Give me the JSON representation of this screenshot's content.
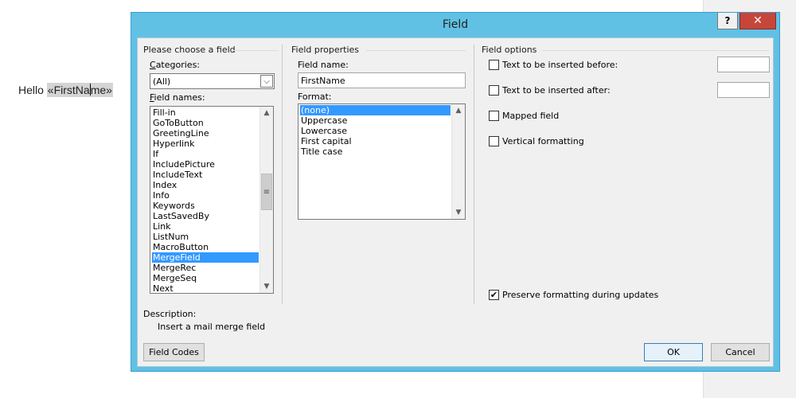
{
  "document": {
    "text_before": "Hello ",
    "field_part1": "«FirstNa",
    "field_part2": "me»"
  },
  "dialog": {
    "title": "Field",
    "help_label": "?",
    "close_label": "✕",
    "choose_group": {
      "title": "Please choose a field",
      "categories_label": "Categories:",
      "categories_value": "(All)",
      "field_names_label": "Field names:",
      "field_names": [
        "Fill-in",
        "GoToButton",
        "GreetingLine",
        "Hyperlink",
        "If",
        "IncludePicture",
        "IncludeText",
        "Index",
        "Info",
        "Keywords",
        "LastSavedBy",
        "Link",
        "ListNum",
        "MacroButton",
        "MergeField",
        "MergeRec",
        "MergeSeq",
        "Next"
      ],
      "selected_field": "MergeField"
    },
    "properties_group": {
      "title": "Field properties",
      "field_name_label": "Field name:",
      "field_name_value": "FirstName",
      "format_label": "Format:",
      "formats": [
        "(none)",
        "Uppercase",
        "Lowercase",
        "First capital",
        "Title case"
      ],
      "selected_format": "(none)"
    },
    "options_group": {
      "title": "Field options",
      "options": [
        {
          "label": "Text to be inserted before:",
          "checked": false,
          "has_input": true,
          "value": ""
        },
        {
          "label": "Text to be inserted after:",
          "checked": false,
          "has_input": true,
          "value": ""
        },
        {
          "label": "Mapped field",
          "checked": false,
          "has_input": false
        },
        {
          "label": "Vertical formatting",
          "checked": false,
          "has_input": false
        }
      ],
      "preserve_label": "Preserve formatting during updates",
      "preserve_checked": true
    },
    "description_label": "Description:",
    "description_text": "Insert a mail merge field",
    "field_codes_button": "Field Codes",
    "ok_button": "OK",
    "cancel_button": "Cancel"
  },
  "icons": {
    "check": "✔",
    "chevron_down": "⌵",
    "scroll_up": "▲",
    "scroll_down": "▼",
    "grip": "≡"
  },
  "colors": {
    "dialog_frame": "#61c1e4",
    "close_button": "#c7463a",
    "selection": "#3399ff"
  }
}
